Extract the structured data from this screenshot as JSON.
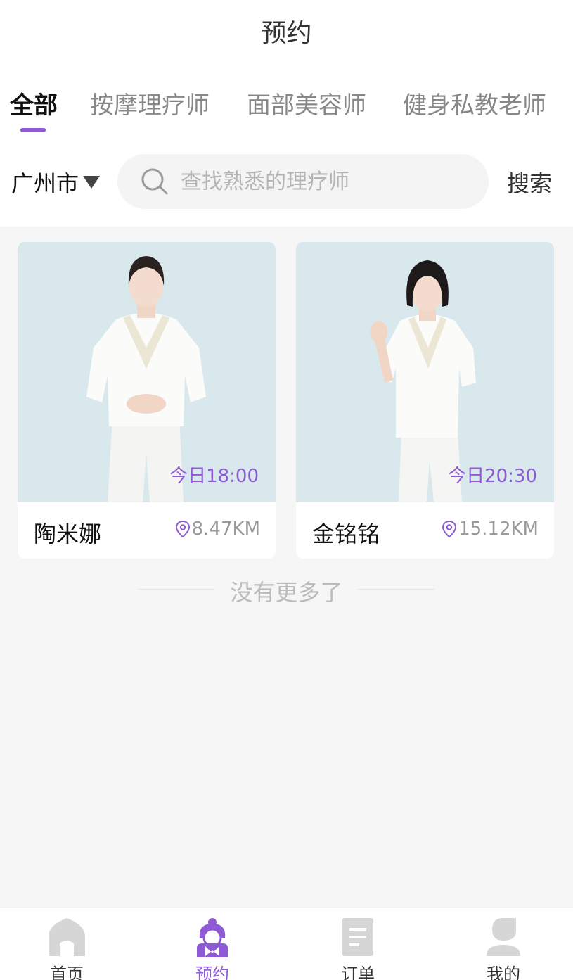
{
  "header": {
    "title": "预约"
  },
  "tabs": [
    {
      "label": "全部",
      "active": true
    },
    {
      "label": "按摩理疗师",
      "active": false
    },
    {
      "label": "面部美容师",
      "active": false
    },
    {
      "label": "健身私教老师",
      "active": false
    }
  ],
  "filter": {
    "city": "广州市",
    "city_icon": "caret-down-icon",
    "search_placeholder": "查找熟悉的理疗师",
    "search_icon": "search-icon",
    "search_button": "搜索"
  },
  "therapists": [
    {
      "name": "陶米娜",
      "available_time": "今日18:00",
      "distance": "8.47KM"
    },
    {
      "name": "金铭铭",
      "available_time": "今日20:30",
      "distance": "15.12KM"
    }
  ],
  "list_footer": "没有更多了",
  "bottom_nav": [
    {
      "label": "首页",
      "icon": "home-icon",
      "active": false
    },
    {
      "label": "预约",
      "icon": "therapist-icon",
      "active": true
    },
    {
      "label": "订单",
      "icon": "order-icon",
      "active": false
    },
    {
      "label": "我的",
      "icon": "profile-icon",
      "active": false
    }
  ],
  "colors": {
    "accent": "#8e5ad6",
    "photo_background": "#d9e8ec",
    "page_background": "#f6f6f6",
    "inactive_icon": "#d6d6d6"
  }
}
